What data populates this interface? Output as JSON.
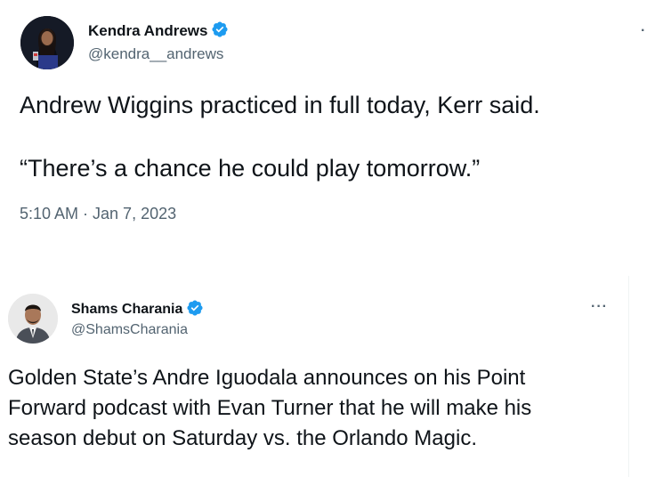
{
  "tweets": [
    {
      "display_name": "Kendra Andrews",
      "handle": "@kendra__andrews",
      "text_line1": "Andrew Wiggins practiced in full today, Kerr said.",
      "text_line2": "“There’s a chance he could play tomorrow.”",
      "timestamp": "5:10 AM · Jan 7, 2023",
      "avatar_icon": "person-avatar",
      "verified_icon": "verified-badge",
      "colors": {
        "verified": "#1d9bf0"
      }
    },
    {
      "display_name": "Shams Charania",
      "handle": "@ShamsCharania",
      "text_line1": "Golden State’s Andre Iguodala announces on his Point",
      "text_line2": "Forward podcast with Evan Turner that he will make his",
      "text_line3": "season debut on Saturday vs. the Orlando Magic.",
      "more_label": "···",
      "avatar_icon": "person-avatar",
      "verified_icon": "verified-badge",
      "colors": {
        "verified": "#1d9bf0"
      }
    }
  ]
}
